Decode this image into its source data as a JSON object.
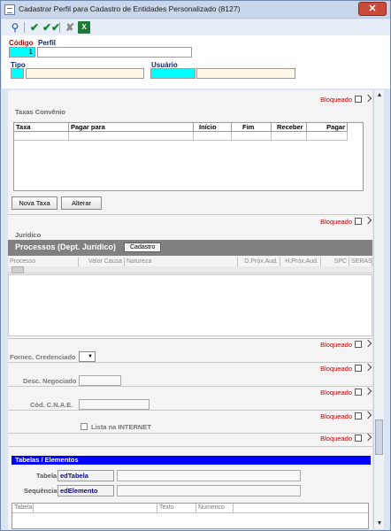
{
  "window": {
    "title": "Cadastrar Perfil para Cadastro de Entidades Personalizado (8127)",
    "close_label": "✕"
  },
  "toolbar": {
    "icons": [
      "search-icon",
      "confirm-icon",
      "confirm-all-icon",
      "cancel-icon",
      "excel-icon"
    ]
  },
  "header": {
    "codigo_label": "Código",
    "codigo_value": "1",
    "perfil_label": "Perfil",
    "perfil_value": "",
    "tipo_label": "Tipo",
    "tipo_value": "",
    "usuario_label": "Usuário",
    "usuario_value": ""
  },
  "colors": {
    "required_field": "#00ffff",
    "required_label": "#c00000",
    "section_bar": "#818181",
    "table_bar": "#0000ff"
  },
  "bloqueado_label": "Bloqueado",
  "taxas": {
    "title": "Taxas Convênio",
    "columns": [
      "Taxa",
      "Pagar para",
      "Início",
      "Fim",
      "Receber",
      "Pagar"
    ],
    "nova_label": "Nova Taxa",
    "alterar_label": "Alterar"
  },
  "juridico": {
    "title": "Jurídico",
    "bar_title": "Processos (Dept. Jurídico)",
    "cadastro_label": "Cadastro",
    "columns": [
      "Processo",
      "Valor Causa",
      "Natureza",
      "D.Próx.Aud.",
      "H.Próx.Aud.",
      "SPC",
      "SERASA"
    ]
  },
  "fields": {
    "fornec_label": "Fornec. Credenciado",
    "desc_label": "Desc. Negociado",
    "cnae_label": "Cód. C.N.A.E.",
    "internet_label": "Lista na INTERNET"
  },
  "tabelas": {
    "bar_title": "Tabelas / Elementos",
    "tabela_label": "Tabela",
    "tabela_value": "edTabela",
    "sequencia_label": "Sequência",
    "sequencia_value": "edElemento",
    "columns": [
      "Tabela",
      "",
      "Texto",
      "Numerico"
    ]
  }
}
